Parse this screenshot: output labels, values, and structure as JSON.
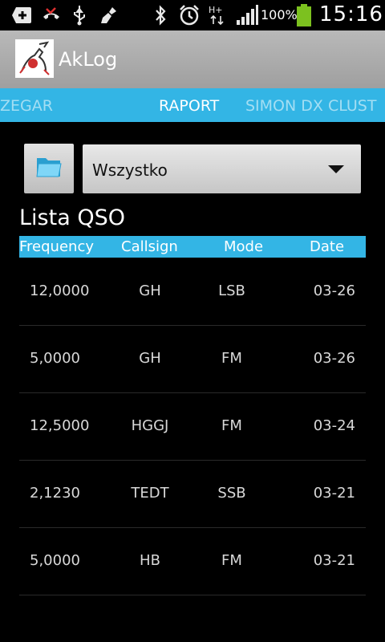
{
  "status_bar": {
    "battery_percent": "100%",
    "time": "15:16",
    "icons": [
      "notification-add-icon",
      "missed-call-icon",
      "usb-icon",
      "broom-icon",
      "bluetooth-icon",
      "alarm-icon",
      "hplus-data-icon",
      "signal-icon",
      "battery-icon"
    ]
  },
  "app": {
    "title": "AkLog"
  },
  "tabs": [
    {
      "label": "ZEGAR",
      "active": false
    },
    {
      "label": "RAPORT",
      "active": true
    },
    {
      "label": "SIMON DX CLUST",
      "active": false
    }
  ],
  "filter": {
    "selected": "Wszystko"
  },
  "section_title": "Lista QSO",
  "table": {
    "headers": [
      "Frequency",
      "Callsign",
      "Mode",
      "Date"
    ],
    "rows": [
      {
        "frequency": "12,0000",
        "callsign": "GH",
        "mode": "LSB",
        "date": "03-26"
      },
      {
        "frequency": "5,0000",
        "callsign": "GH",
        "mode": "FM",
        "date": "03-26"
      },
      {
        "frequency": "12,5000",
        "callsign": "HGGJ",
        "mode": "FM",
        "date": "03-24"
      },
      {
        "frequency": "2,1230",
        "callsign": "TEDT",
        "mode": "SSB",
        "date": "03-21"
      },
      {
        "frequency": "5,0000",
        "callsign": "HB",
        "mode": "FM",
        "date": "03-21"
      }
    ]
  },
  "colors": {
    "accent": "#33b5e5",
    "action_bar": "#a8a8a8",
    "background": "#000000"
  }
}
